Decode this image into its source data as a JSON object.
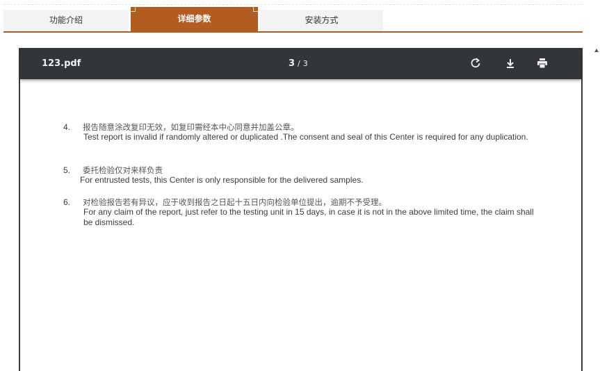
{
  "tabs": [
    {
      "label": "功能介绍",
      "active": false
    },
    {
      "label": "详细参数",
      "active": true
    },
    {
      "label": "安装方式",
      "active": false
    }
  ],
  "colors": {
    "accent": "#b35c22",
    "toolbar": "#323639"
  },
  "viewer": {
    "filename": "123.pdf",
    "current_page": "3",
    "separator": "/",
    "total_pages": "3",
    "icons": [
      "rotate-icon",
      "download-icon",
      "print-icon"
    ]
  },
  "document": {
    "items": [
      {
        "num": "4.",
        "cn": "报告随意涂改复印无效，如复印需经本中心同意并加盖公章。",
        "en": "Test report is invalid if randomly altered or duplicated .The consent and seal of this Center is required for any duplication."
      },
      {
        "num": "5.",
        "cn": "委托检验仅对来样负责",
        "en": "For entrusted tests, this Center is only responsible for the delivered samples."
      },
      {
        "num": "6.",
        "cn": "对检验报告若有异议，应于收到报告之日起十五日内向检验单位提出，逾期不予受理。",
        "en": "For any claim of the report, just refer to the testing unit in 15 days, in case it is not in the above limited time, the claim shall be dismissed."
      }
    ]
  }
}
